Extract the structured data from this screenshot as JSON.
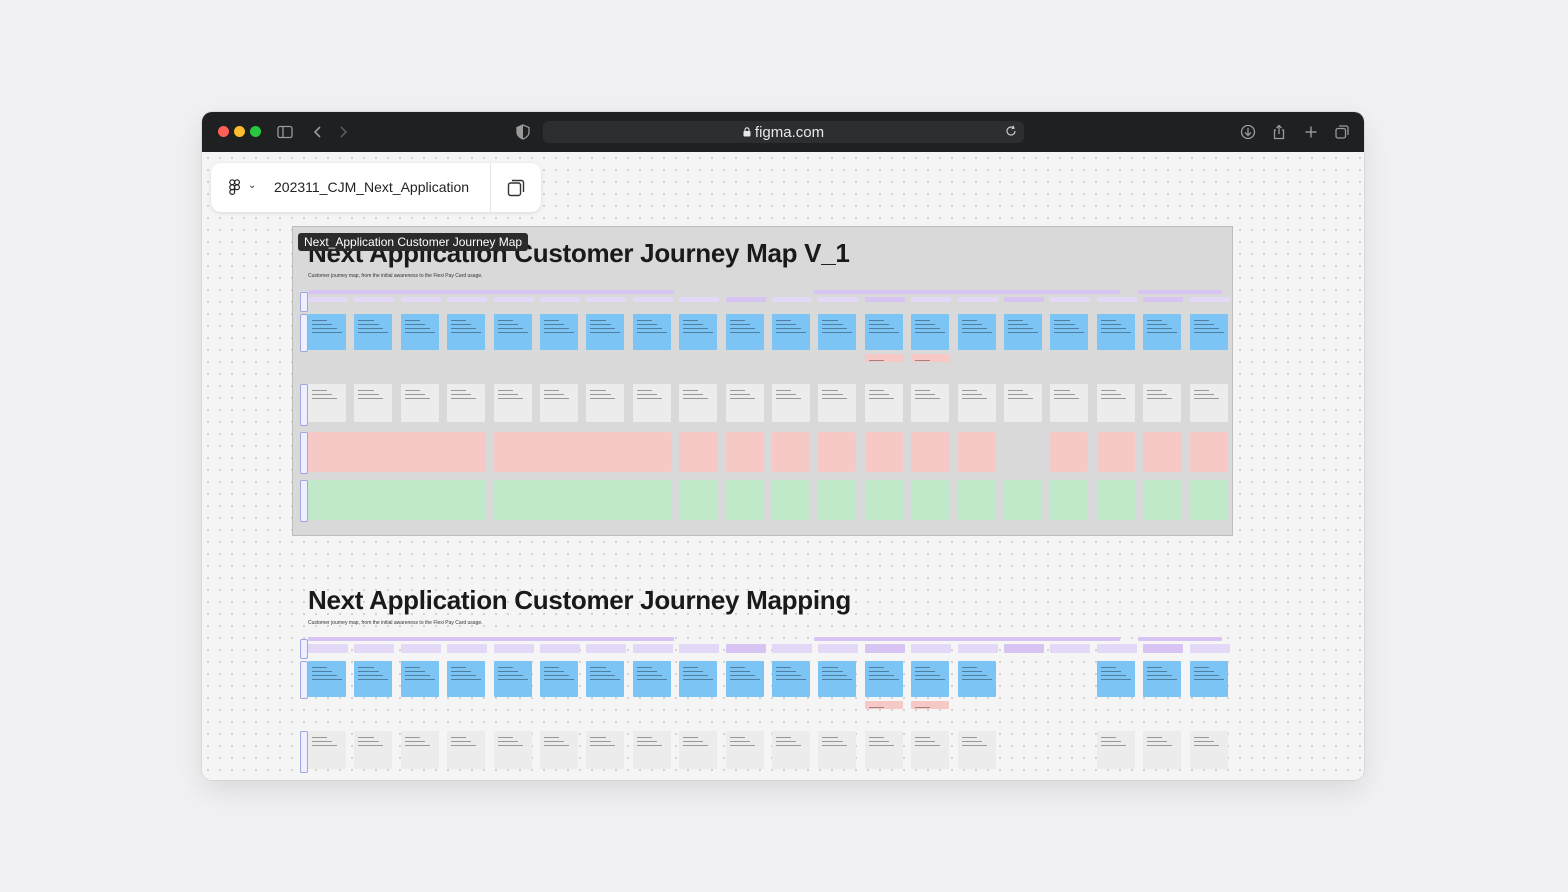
{
  "browser": {
    "url": "figma.com",
    "traffic_lights": [
      "#ff5f57",
      "#febc2e",
      "#28c840"
    ]
  },
  "file": {
    "name": "202311_CJM_Next_Application"
  },
  "frames": [
    {
      "label": "Next_Application Customer Journey Map",
      "title": "Next Application Customer Journey Map V_1",
      "subtitle": "Customer journey map, from the initial awareness to the Flexi Pay Card usage."
    },
    {
      "title": "Next Application Customer Journey Mapping",
      "subtitle": "Customer journey map, from the initial awareness to the Flexi Pay Card usage."
    }
  ],
  "colors": {
    "stage": "#d7c4f3",
    "action": "#7cc4f4",
    "touchpoint": "#ececec",
    "pain": "#f6c9c6",
    "opportunity": "#bfe9c9"
  }
}
